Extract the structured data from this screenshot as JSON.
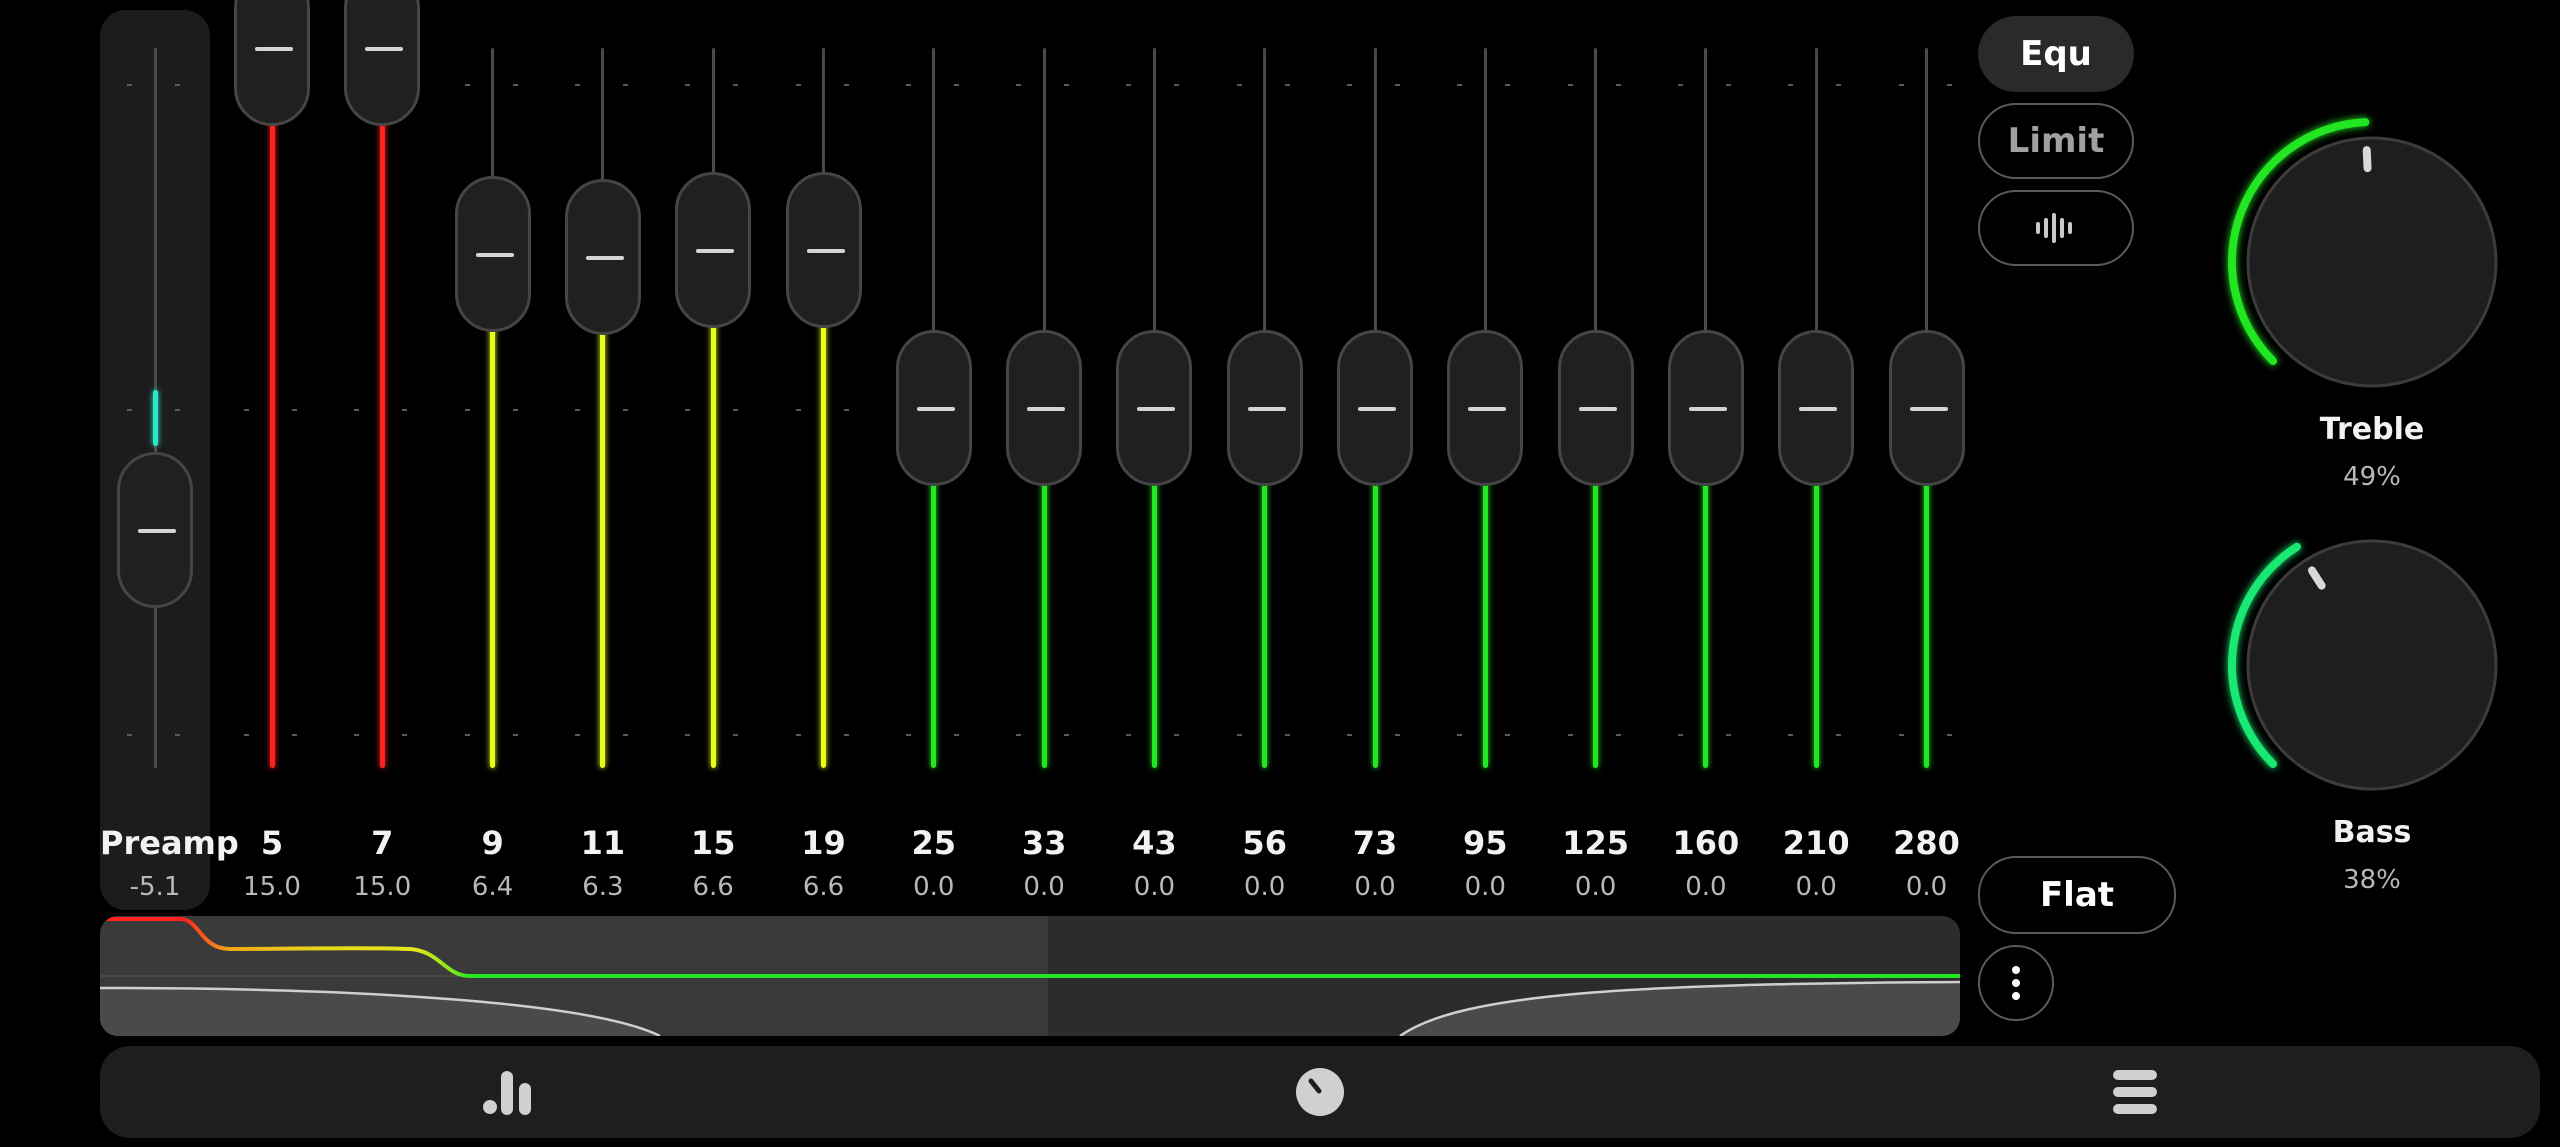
{
  "preamp": {
    "label": "Preamp",
    "value": "-5.1",
    "level_db": -5.1,
    "indicator_color": "#2ee6c8"
  },
  "bands": [
    {
      "freq": "5",
      "gain": "15.0",
      "gain_db": 15.0,
      "color": "#ff2020"
    },
    {
      "freq": "7",
      "gain": "15.0",
      "gain_db": 15.0,
      "color": "#ff2020"
    },
    {
      "freq": "9",
      "gain": "6.4",
      "gain_db": 6.4,
      "color": "#e6ff1a"
    },
    {
      "freq": "11",
      "gain": "6.3",
      "gain_db": 6.3,
      "color": "#e6ff1a"
    },
    {
      "freq": "15",
      "gain": "6.6",
      "gain_db": 6.6,
      "color": "#e6ff1a"
    },
    {
      "freq": "19",
      "gain": "6.6",
      "gain_db": 6.6,
      "color": "#e6ff1a"
    },
    {
      "freq": "25",
      "gain": "0.0",
      "gain_db": 0.0,
      "color": "#22e622"
    },
    {
      "freq": "33",
      "gain": "0.0",
      "gain_db": 0.0,
      "color": "#22e622"
    },
    {
      "freq": "43",
      "gain": "0.0",
      "gain_db": 0.0,
      "color": "#22e622"
    },
    {
      "freq": "56",
      "gain": "0.0",
      "gain_db": 0.0,
      "color": "#22e622"
    },
    {
      "freq": "73",
      "gain": "0.0",
      "gain_db": 0.0,
      "color": "#22e622"
    },
    {
      "freq": "95",
      "gain": "0.0",
      "gain_db": 0.0,
      "color": "#22e622"
    },
    {
      "freq": "125",
      "gain": "0.0",
      "gain_db": 0.0,
      "color": "#22e622"
    },
    {
      "freq": "160",
      "gain": "0.0",
      "gain_db": 0.0,
      "color": "#22e622"
    },
    {
      "freq": "210",
      "gain": "0.0",
      "gain_db": 0.0,
      "color": "#22e622"
    },
    {
      "freq": "280",
      "gain": "0.0",
      "gain_db": 0.0,
      "color": "#22e622"
    }
  ],
  "modes": {
    "equ_label": "Equ",
    "limit_label": "Limit",
    "visualizer_icon": "waveform-icon"
  },
  "flat_label": "Flat",
  "more_icon": "vertical-dots-icon",
  "treble": {
    "label": "Treble",
    "value": "49%",
    "percent": 49,
    "color": "#22e622"
  },
  "bass": {
    "label": "Bass",
    "value": "38%",
    "percent": 38,
    "color": "#19e873"
  },
  "nav": {
    "items": [
      {
        "icon": "equalizer-bars-icon"
      },
      {
        "icon": "dial-icon"
      },
      {
        "icon": "menu-stack-icon"
      }
    ]
  },
  "colors": {
    "boost_high": "#ff2020",
    "boost_mid": "#e6ff1a",
    "neutral": "#22e622",
    "background": "#000000"
  }
}
